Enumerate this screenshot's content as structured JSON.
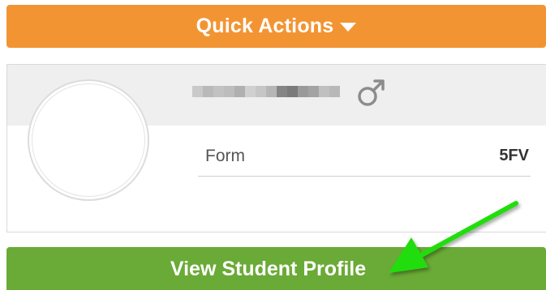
{
  "quick_actions": {
    "label": "Quick Actions",
    "icon": "caret-down-icon"
  },
  "student": {
    "name_redacted": true,
    "gender_icon": "male-symbol-icon",
    "form_label": "Form",
    "form_value": "5FV"
  },
  "view_profile": {
    "label": "View Student Profile"
  },
  "colors": {
    "quick_actions_bg": "#f39433",
    "view_profile_bg": "#6aaa36",
    "card_header_bg": "#efefef",
    "annotation_arrow": "#22dd11"
  }
}
